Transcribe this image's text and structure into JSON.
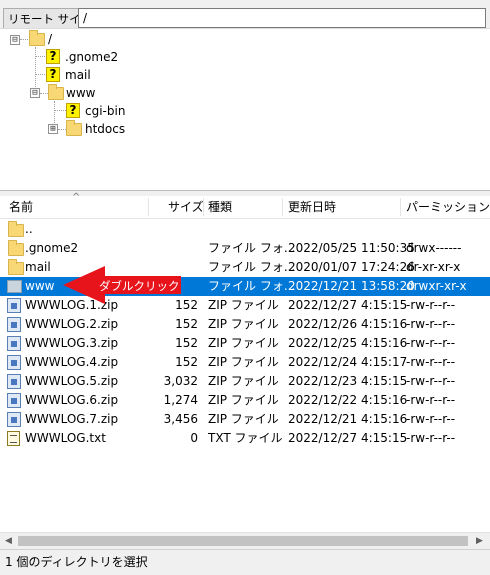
{
  "site_bar": {
    "label": "リモート サイト:",
    "path": "/"
  },
  "tree": {
    "items": [
      {
        "label": "/",
        "expander": "⊟"
      },
      {
        "label": ".gnome2"
      },
      {
        "label": "mail"
      },
      {
        "label": "www",
        "expander": "⊟"
      },
      {
        "label": "cgi-bin"
      },
      {
        "label": "htdocs",
        "expander": "⊞"
      }
    ]
  },
  "columns": {
    "name": "名前",
    "size": "サイズ",
    "type": "種類",
    "modified": "更新日時",
    "permission": "パーミッション"
  },
  "files": [
    {
      "name": "..",
      "size": "",
      "type": "",
      "modified": "",
      "permission": "",
      "icon": "folder-icon"
    },
    {
      "name": ".gnome2",
      "size": "",
      "type": "ファイル フォ...",
      "modified": "2022/05/25 11:50:35",
      "permission": "drwx------",
      "icon": "folder-icon"
    },
    {
      "name": "mail",
      "size": "",
      "type": "ファイル フォ...",
      "modified": "2020/01/07 17:24:26",
      "permission": "dr-xr-xr-x",
      "icon": "folder-icon"
    },
    {
      "name": "www",
      "size": "",
      "type": "ファイル フォ...",
      "modified": "2022/12/21 13:58:20",
      "permission": "drwxr-xr-x",
      "icon": "folder-icon",
      "selected": true
    },
    {
      "name": "WWWLOG.1.zip",
      "size": "152",
      "type": "ZIP ファイル",
      "modified": "2022/12/27 4:15:15",
      "permission": "-rw-r--r--",
      "icon": "zip-file-icon"
    },
    {
      "name": "WWWLOG.2.zip",
      "size": "152",
      "type": "ZIP ファイル",
      "modified": "2022/12/26 4:15:16",
      "permission": "-rw-r--r--",
      "icon": "zip-file-icon"
    },
    {
      "name": "WWWLOG.3.zip",
      "size": "152",
      "type": "ZIP ファイル",
      "modified": "2022/12/25 4:15:16",
      "permission": "-rw-r--r--",
      "icon": "zip-file-icon"
    },
    {
      "name": "WWWLOG.4.zip",
      "size": "152",
      "type": "ZIP ファイル",
      "modified": "2022/12/24 4:15:17",
      "permission": "-rw-r--r--",
      "icon": "zip-file-icon"
    },
    {
      "name": "WWWLOG.5.zip",
      "size": "3,032",
      "type": "ZIP ファイル",
      "modified": "2022/12/23 4:15:15",
      "permission": "-rw-r--r--",
      "icon": "zip-file-icon"
    },
    {
      "name": "WWWLOG.6.zip",
      "size": "1,274",
      "type": "ZIP ファイル",
      "modified": "2022/12/22 4:15:16",
      "permission": "-rw-r--r--",
      "icon": "zip-file-icon"
    },
    {
      "name": "WWWLOG.7.zip",
      "size": "3,456",
      "type": "ZIP ファイル",
      "modified": "2022/12/21 4:15:16",
      "permission": "-rw-r--r--",
      "icon": "zip-file-icon"
    },
    {
      "name": "WWWLOG.txt",
      "size": "0",
      "type": "TXT ファイル",
      "modified": "2022/12/27 4:15:15",
      "permission": "-rw-r--r--",
      "icon": "text-file-icon"
    }
  ],
  "annotation": {
    "text": "ダブルクリック",
    "color": "#e8141c"
  },
  "status": {
    "text": "1 個のディレクトリを選択"
  },
  "colors": {
    "selection": "#0078d7",
    "folder": "#f8d775",
    "annotation": "#e8141c"
  }
}
